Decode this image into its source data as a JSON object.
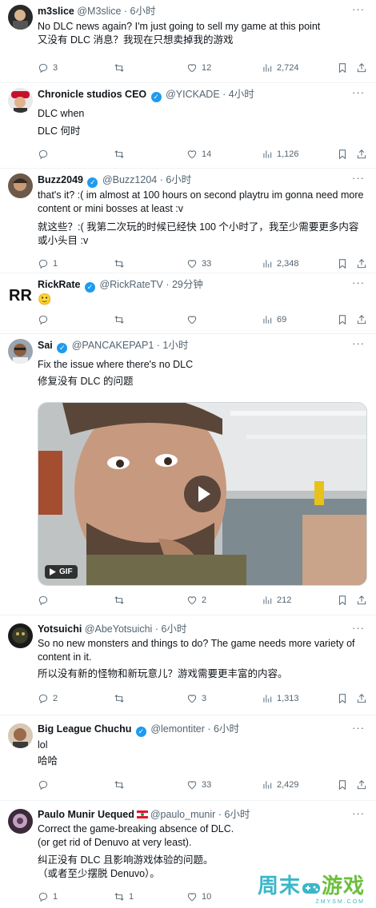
{
  "tweets": [
    {
      "name": "m3slice",
      "handle": "@M3slice",
      "time": "6小时",
      "verified": false,
      "lines": [
        "No DLC news again? I'm just going to sell my game at this point",
        "又没有 DLC 消息？我现在只想卖掉我的游戏"
      ],
      "replies": "3",
      "retweets": "",
      "likes": "12",
      "views": "2,724"
    },
    {
      "name": "Chronicle studios CEO",
      "handle": "@YICKADE",
      "time": "4小时",
      "verified": true,
      "lines": [
        "DLC when",
        "DLC 何时"
      ],
      "replies": "",
      "retweets": "",
      "likes": "14",
      "views": "1,126"
    },
    {
      "name": "Buzz2049",
      "handle": "@Buzz1204",
      "time": "6小时",
      "verified": true,
      "lines": [
        "that's it? :( im almost at 100 hours on second playtru im gonna need more content or mini bosses at least :v",
        "就这些？:( 我第二次玩的时候已经快 100 个小时了，我至少需要更多内容或小头目 :v"
      ],
      "replies": "1",
      "retweets": "",
      "likes": "33",
      "views": "2,348"
    },
    {
      "name": "RickRate",
      "handle": "@RickRateTV",
      "time": "29分钟",
      "verified": true,
      "lines": [
        "🙂"
      ],
      "replies": "",
      "retweets": "",
      "likes": "",
      "views": "69"
    },
    {
      "name": "Sai",
      "handle": "@PANCAKEPAP1",
      "time": "1小时",
      "verified": true,
      "lines": [
        "Fix the issue where there's no DLC",
        "修复没有 DLC 的问题"
      ],
      "gif_label": "GIF",
      "replies": "",
      "retweets": "",
      "likes": "2",
      "views": "212"
    },
    {
      "name": "Yotsuichi",
      "handle": "@AbeYotsuichi",
      "time": "6小时",
      "verified": false,
      "lines": [
        "So no new monsters and things to do? The game needs more variety of content in it.",
        "所以没有新的怪物和新玩意儿？游戏需要更丰富的内容。"
      ],
      "replies": "2",
      "retweets": "",
      "likes": "3",
      "views": "1,313"
    },
    {
      "name": "Big League Chuchu",
      "handle": "@lemontiter",
      "time": "6小时",
      "verified": true,
      "lines": [
        "lol",
        "哈哈"
      ],
      "replies": "",
      "retweets": "",
      "likes": "33",
      "views": "2,429"
    },
    {
      "name": "Paulo Munir Uequed",
      "handle": "@paulo_munir",
      "time": "6小时",
      "verified": false,
      "lines": [
        "Correct the game-breaking absence of DLC.",
        "(or get rid of Denuvo at very least).",
        "纠正没有 DLC 且影响游戏体验的问题。",
        "（或者至少摆脱 Denuvo）。"
      ],
      "replies": "1",
      "retweets": "1",
      "likes": "10",
      "views": ""
    }
  ],
  "watermark": {
    "text_a": "周末",
    "text_b": "游戏",
    "sub": "ZMYSM.COM"
  },
  "colors": {
    "text": "#0f1419",
    "muted": "#536471",
    "blue": "#1d9bf0",
    "divider": "#eff3f4"
  }
}
